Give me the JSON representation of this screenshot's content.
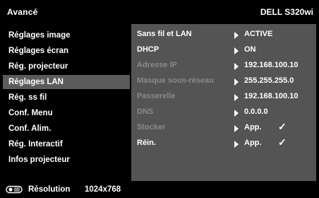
{
  "header": {
    "title": "Avancé",
    "model": "DELL S320wi"
  },
  "sidebar": {
    "items": [
      {
        "label": "Réglages image",
        "selected": false
      },
      {
        "label": "Réglages écran",
        "selected": false
      },
      {
        "label": "Rég. projecteur",
        "selected": false
      },
      {
        "label": "Réglages LAN",
        "selected": true
      },
      {
        "label": "Rég. ss fil",
        "selected": false
      },
      {
        "label": "Conf. Menu",
        "selected": false
      },
      {
        "label": "Conf. Alim.",
        "selected": false
      },
      {
        "label": "Rég. Interactif",
        "selected": false
      },
      {
        "label": "Infos projecteur",
        "selected": false
      }
    ]
  },
  "settings": {
    "rows": [
      {
        "label": "Sans fil et LAN",
        "value": "ACTIVE",
        "enabled": true,
        "check": ""
      },
      {
        "label": "DHCP",
        "value": "ON",
        "enabled": true,
        "check": ""
      },
      {
        "label": "Adresse IP",
        "value": "192.168.100.10",
        "enabled": false,
        "check": ""
      },
      {
        "label": "Masque sous-réseau",
        "value": "255.255.255.0",
        "enabled": false,
        "check": ""
      },
      {
        "label": "Passerelle",
        "value": "192.168.100.10",
        "enabled": false,
        "check": ""
      },
      {
        "label": "DNS",
        "value": "0.0.0.0",
        "enabled": false,
        "check": ""
      },
      {
        "label": "Stocker",
        "value": "App.",
        "enabled": false,
        "check": "✓"
      },
      {
        "label": "Réin.",
        "value": "App.",
        "enabled": true,
        "check": "✓"
      }
    ]
  },
  "status": {
    "resolution_label": "Résolution",
    "resolution_value": "1024x768",
    "icon": "projector-icon"
  },
  "colors": {
    "background": "#000000",
    "panel": "#545454",
    "selected": "#5b5b5b",
    "disabled_text": "#8a8a8a"
  }
}
